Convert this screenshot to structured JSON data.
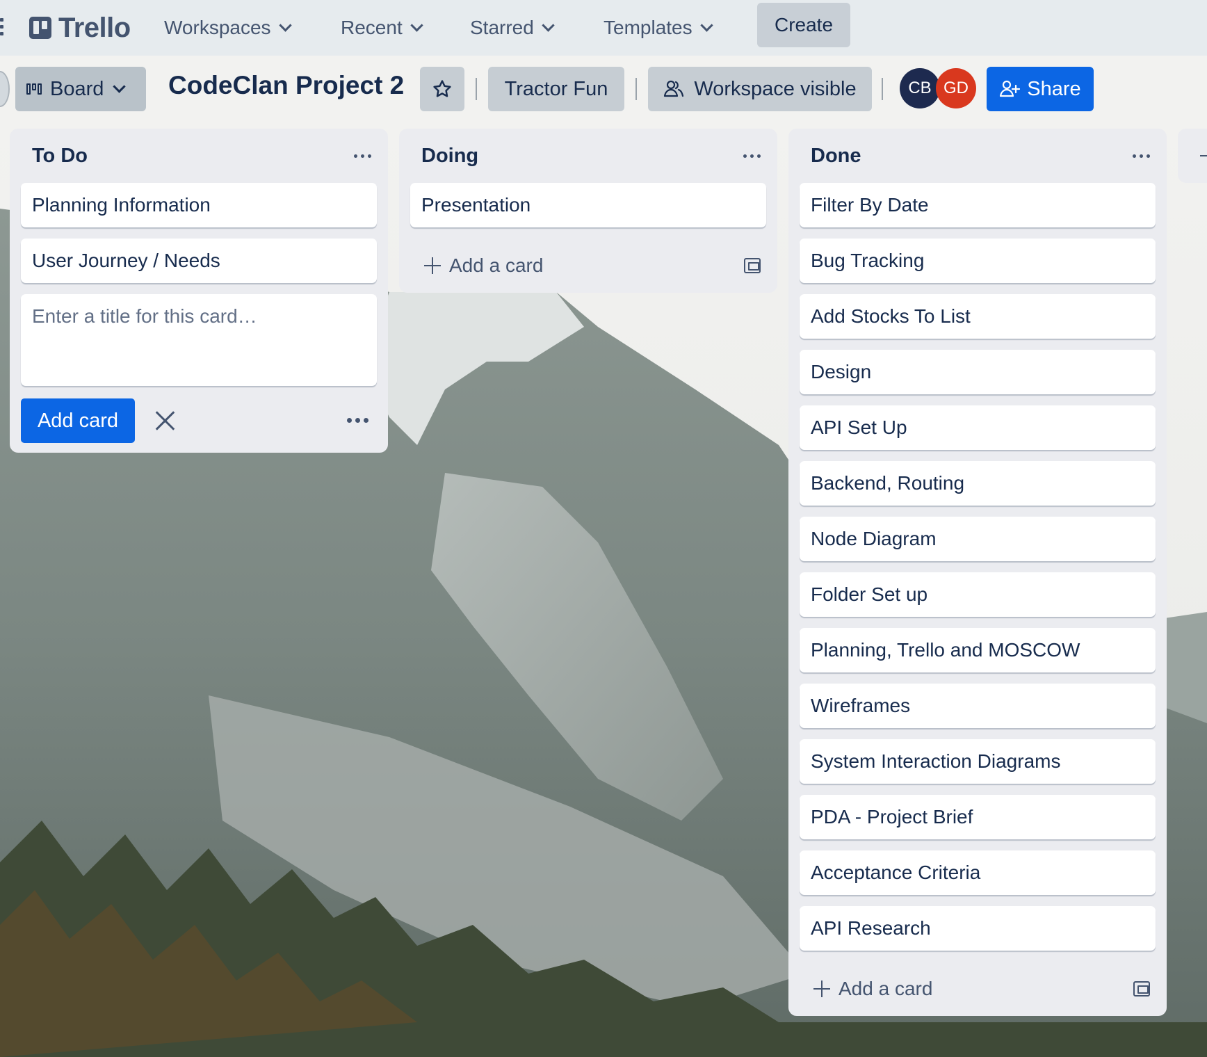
{
  "topbar": {
    "logo_text": "Trello",
    "nav": [
      {
        "label": "Workspaces"
      },
      {
        "label": "Recent"
      },
      {
        "label": "Starred"
      },
      {
        "label": "Templates"
      }
    ],
    "create_label": "Create"
  },
  "board": {
    "view_label": "Board",
    "title": "CodeClan Project 2",
    "workspace_name": "Tractor Fun",
    "visibility_label": "Workspace visible",
    "members": [
      {
        "initials": "CB",
        "color": "#1d2a4f"
      },
      {
        "initials": "GD",
        "color": "#d9381e"
      }
    ],
    "share_label": "Share"
  },
  "lists": [
    {
      "title": "To Do",
      "cards": [
        "Planning Information",
        "User Journey / Needs"
      ],
      "composer": {
        "placeholder": "Enter a title for this card…",
        "add_label": "Add card"
      }
    },
    {
      "title": "Doing",
      "cards": [
        "Presentation"
      ],
      "add_label": "Add a card"
    },
    {
      "title": "Done",
      "cards": [
        "Filter By Date",
        "Bug Tracking",
        "Add Stocks To List",
        "Design",
        "API Set Up",
        "Backend, Routing",
        "Node Diagram",
        "Folder Set up",
        "Planning, Trello and MOSCOW",
        "Wireframes",
        "System Interaction Diagrams",
        "PDA - Project Brief",
        "Acceptance Criteria",
        "API Research"
      ],
      "add_label": "Add a card"
    }
  ],
  "colors": {
    "accent": "#0c66e4",
    "list_bg": "#ebecf0",
    "topbar_bg": "#e6ebee"
  }
}
